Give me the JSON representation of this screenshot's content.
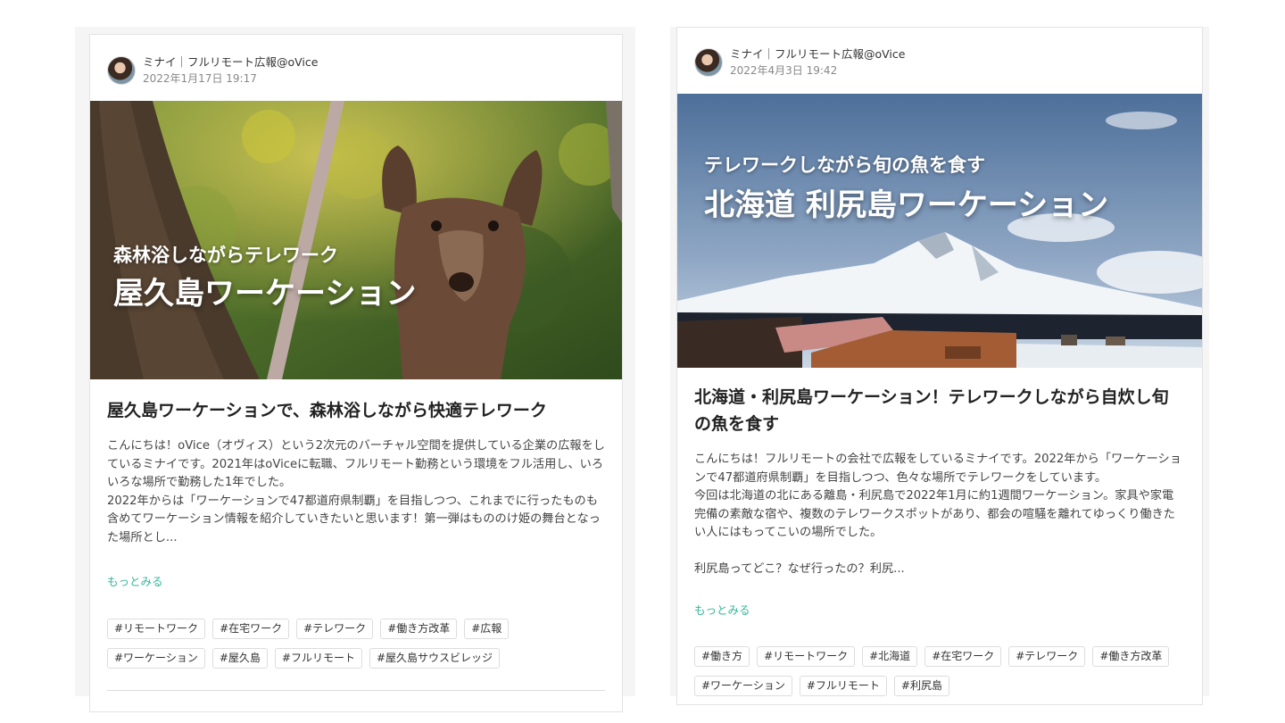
{
  "posts": [
    {
      "author": "ミナイ｜フルリモート広報@oVice",
      "date": "2022年1月17日 19:17",
      "hero_kicker": "森林浴しながらテレワーク",
      "hero_title": "屋久島ワーケーション",
      "title": "屋久島ワーケーションで、森林浴しながら快適テレワーク",
      "body": [
        "こんにちは！oVice（オヴィス）という2次元のバーチャル空間を提供している企業の広報をしているミナイです。2021年はoViceに転職、フルリモート勤務という環境をフル活用し、いろいろな場所で勤務した1年でした。",
        "2022年からは「ワーケーションで47都道府県制覇」を目指しつつ、これまでに行ったものも含めてワーケーション情報を紹介していきたいと思います！第一弾はもののけ姫の舞台となった場所とし..."
      ],
      "more": "もっとみる",
      "tags": [
        "#リモートワーク",
        "#在宅ワーク",
        "#テレワーク",
        "#働き方改革",
        "#広報",
        "#ワーケーション",
        "#屋久島",
        "#フルリモート",
        "#屋久島サウスビレッジ"
      ]
    },
    {
      "author": "ミナイ｜フルリモート広報@oVice",
      "date": "2022年4月3日 19:42",
      "hero_kicker": "テレワークしながら旬の魚を食す",
      "hero_title": "北海道 利尻島ワーケーション",
      "title": "北海道・利尻島ワーケーション！テレワークしながら自炊し旬の魚を食す",
      "body": [
        "こんにちは！フルリモートの会社で広報をしているミナイです。2022年から「ワーケーションで47都道府県制覇」を目指しつつ、色々な場所でテレワークをしています。",
        "今回は北海道の北にある離島・利尻島で2022年1月に約1週間ワーケーション。家具や家電完備の素敵な宿や、複数のテレワークスポットがあり、都会の喧騒を離れてゆっくり働きたい人にはもってこいの場所でした。",
        "",
        "利尻島ってどこ？なぜ行ったの？利尻..."
      ],
      "more": "もっとみる",
      "tags": [
        "#働き方",
        "#リモートワーク",
        "#北海道",
        "#在宅ワーク",
        "#テレワーク",
        "#働き方改革",
        "#ワーケーション",
        "#フルリモート",
        "#利尻島"
      ]
    }
  ],
  "icons": {
    "avatar": "author-avatar-photo"
  },
  "colors": {
    "link": "#35b59a",
    "panel": "#f5f5f5"
  }
}
